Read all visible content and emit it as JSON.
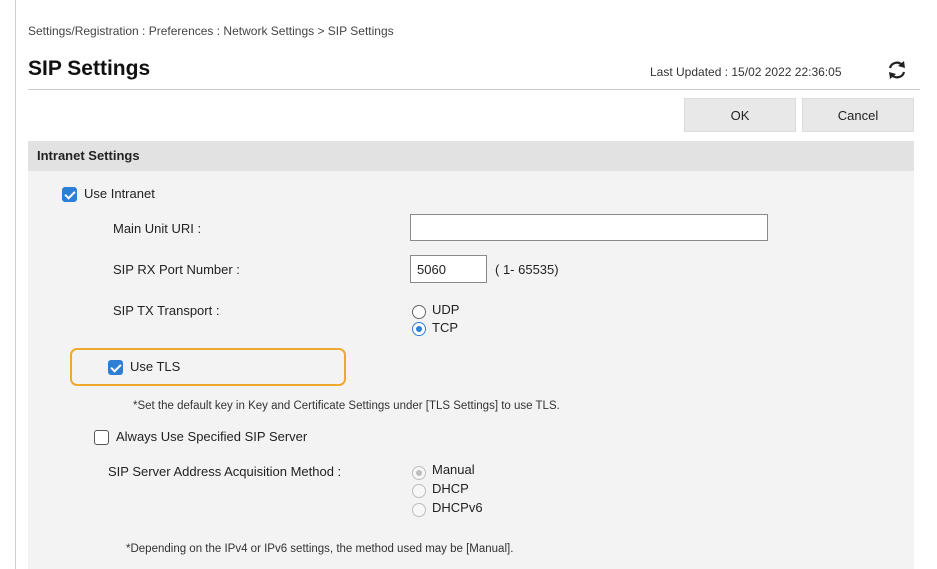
{
  "breadcrumb": "Settings/Registration : Preferences : Network Settings > SIP Settings",
  "title": "SIP Settings",
  "last_updated": "Last Updated : 15/02 2022 22:36:05",
  "buttons": {
    "ok": "OK",
    "cancel": "Cancel"
  },
  "section": {
    "header": "Intranet Settings",
    "use_intranet": {
      "label": "Use Intranet",
      "checked": true
    },
    "main_unit_uri": {
      "label": "Main Unit URI :",
      "value": ""
    },
    "sip_rx_port": {
      "label": "SIP RX Port Number :",
      "value": "5060",
      "range": "( 1- 65535)"
    },
    "sip_tx_transport": {
      "label": "SIP TX Transport :",
      "options": [
        "UDP",
        "TCP"
      ],
      "selected": "TCP"
    },
    "use_tls": {
      "label": "Use TLS",
      "checked": true
    },
    "tls_note": "*Set the default key in Key and Certificate Settings under [TLS Settings] to use TLS.",
    "always_use_sip_server": {
      "label": "Always Use Specified SIP Server",
      "checked": false
    },
    "acquisition_method": {
      "label": "SIP Server Address Acquisition Method :",
      "options": [
        "Manual",
        "DHCP",
        "DHCPv6"
      ],
      "selected": "Manual"
    },
    "ipv_note": "*Depending on the IPv4 or IPv6 settings, the method used may be [Manual]."
  },
  "colors": {
    "accent": "#2d7fd6",
    "highlight": "#f0a830",
    "section_bg": "#f3f3f3",
    "header_bg": "#e2e2e2"
  }
}
